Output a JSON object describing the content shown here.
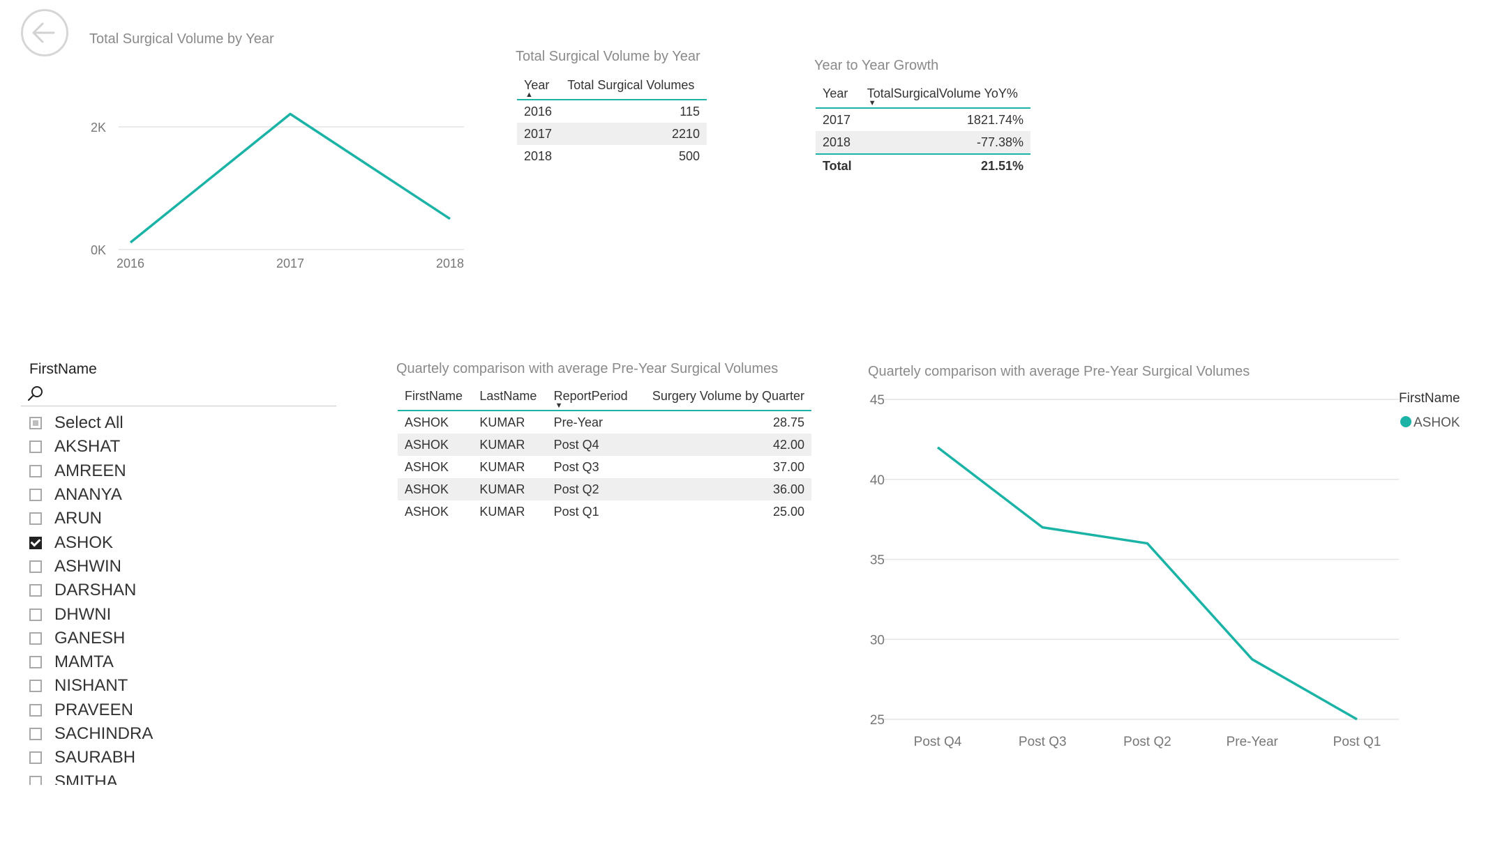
{
  "back_button": {
    "icon": "back-arrow-icon"
  },
  "colors": {
    "accent": "#1ab3a6",
    "grid": "#e4e4e4",
    "title": "#8a8a8a"
  },
  "line_chart_1": {
    "title": "Total Surgical Volume by Year"
  },
  "table_year": {
    "title": "Total Surgical Volume by Year",
    "columns": [
      "Year",
      "Total Surgical Volumes"
    ],
    "rows": [
      [
        "2016",
        "115"
      ],
      [
        "2017",
        "2210"
      ],
      [
        "2018",
        "500"
      ]
    ]
  },
  "table_growth": {
    "title": "Year to Year Growth",
    "columns": [
      "Year",
      "TotalSurgicalVolume YoY%"
    ],
    "rows": [
      [
        "2017",
        "1821.74%"
      ],
      [
        "2018",
        "-77.38%"
      ]
    ],
    "total": [
      "Total",
      "21.51%"
    ]
  },
  "slicer": {
    "header": "FirstName",
    "search_icon": "search-icon",
    "items": [
      {
        "label": "Select All",
        "state": "partial"
      },
      {
        "label": "AKSHAT",
        "state": "unchecked"
      },
      {
        "label": "AMREEN",
        "state": "unchecked"
      },
      {
        "label": "ANANYA",
        "state": "unchecked"
      },
      {
        "label": "ARUN",
        "state": "unchecked"
      },
      {
        "label": "ASHOK",
        "state": "checked"
      },
      {
        "label": "ASHWIN",
        "state": "unchecked"
      },
      {
        "label": "DARSHAN",
        "state": "unchecked"
      },
      {
        "label": "DHWNI",
        "state": "unchecked"
      },
      {
        "label": "GANESH",
        "state": "unchecked"
      },
      {
        "label": "MAMTA",
        "state": "unchecked"
      },
      {
        "label": "NISHANT",
        "state": "unchecked"
      },
      {
        "label": "PRAVEEN",
        "state": "unchecked"
      },
      {
        "label": "SACHINDRA",
        "state": "unchecked"
      },
      {
        "label": "SAURABH",
        "state": "unchecked"
      },
      {
        "label": "SMITHA",
        "state": "unchecked"
      }
    ]
  },
  "table_quarterly": {
    "title": "Quartely comparison with average Pre-Year Surgical Volumes",
    "columns": [
      "FirstName",
      "LastName",
      "ReportPeriod",
      "Surgery Volume by Quarter"
    ],
    "rows": [
      [
        "ASHOK",
        "KUMAR",
        "Pre-Year",
        "28.75"
      ],
      [
        "ASHOK",
        "KUMAR",
        "Post Q4",
        "42.00"
      ],
      [
        "ASHOK",
        "KUMAR",
        "Post Q3",
        "37.00"
      ],
      [
        "ASHOK",
        "KUMAR",
        "Post Q2",
        "36.00"
      ],
      [
        "ASHOK",
        "KUMAR",
        "Post Q1",
        "25.00"
      ]
    ]
  },
  "line_chart_2": {
    "title": "Quartely comparison with average Pre-Year Surgical Volumes",
    "legend_title": "FirstName"
  },
  "chart_data": [
    {
      "type": "line",
      "title": "Total Surgical Volume by Year",
      "x": [
        "2016",
        "2017",
        "2018"
      ],
      "series": [
        {
          "values": [
            115,
            2210,
            500
          ]
        }
      ],
      "yticks": [
        "0K",
        "2K"
      ],
      "ylim": [
        0,
        2000
      ],
      "grid": true,
      "color": "#1ab3a6"
    },
    {
      "type": "line",
      "title": "Quartely comparison with average Pre-Year Surgical Volumes",
      "x": [
        "Post Q4",
        "Post Q3",
        "Post Q2",
        "Pre-Year",
        "Post Q1"
      ],
      "series": [
        {
          "name": "ASHOK",
          "values": [
            42.0,
            37.0,
            36.0,
            28.75,
            25.0
          ]
        }
      ],
      "yticks": [
        "25",
        "30",
        "35",
        "40",
        "45"
      ],
      "ylim": [
        25,
        45
      ],
      "grid": true,
      "legend_title": "FirstName",
      "legend_position": "top-right",
      "color": "#1ab3a6"
    }
  ]
}
